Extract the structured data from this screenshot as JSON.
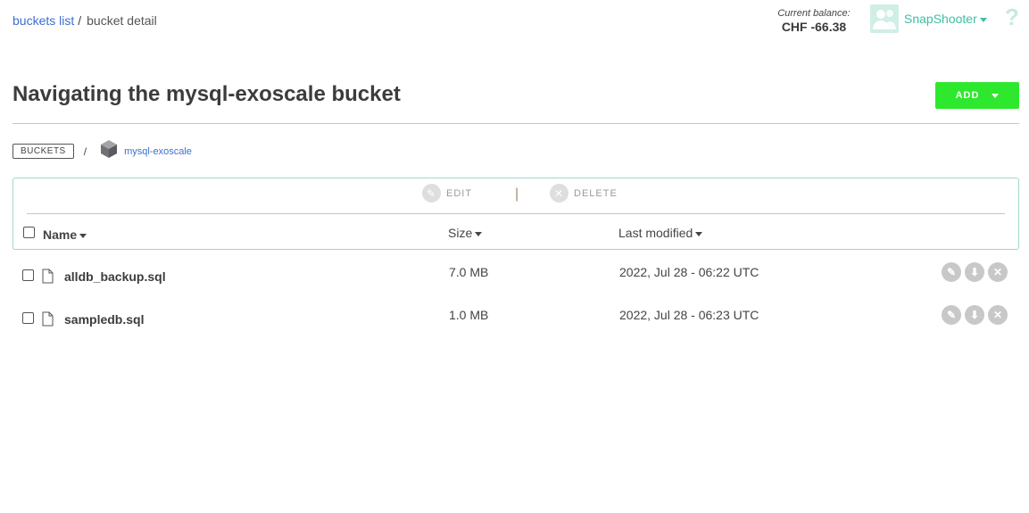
{
  "topbar": {
    "crumb_link": "buckets list",
    "crumb_sep": "/",
    "crumb_current": "bucket detail",
    "balance_label": "Current balance:",
    "balance_value": "CHF -66.38",
    "user_name": "SnapShooter",
    "help_symbol": "?"
  },
  "page": {
    "title": "Navigating the mysql-exoscale bucket",
    "add_label": "ADD"
  },
  "path": {
    "root_label": "BUCKETS",
    "sep": "/",
    "bucket_name": "mysql-exoscale"
  },
  "toolbar": {
    "edit_label": "EDIT",
    "delete_label": "DELETE",
    "sep": "|"
  },
  "table": {
    "columns": {
      "name": "Name",
      "size": "Size",
      "modified": "Last modified"
    },
    "rows": [
      {
        "name": "alldb_backup.sql",
        "size": "7.0 MB",
        "modified": "2022, Jul 28 - 06:22 UTC"
      },
      {
        "name": "sampledb.sql",
        "size": "1.0 MB",
        "modified": "2022, Jul 28 - 06:23 UTC"
      }
    ]
  },
  "colors": {
    "accent": "#3dbfa5",
    "add": "#2ee82e",
    "link": "#3c6fd1",
    "border": "#9ed9c8"
  }
}
